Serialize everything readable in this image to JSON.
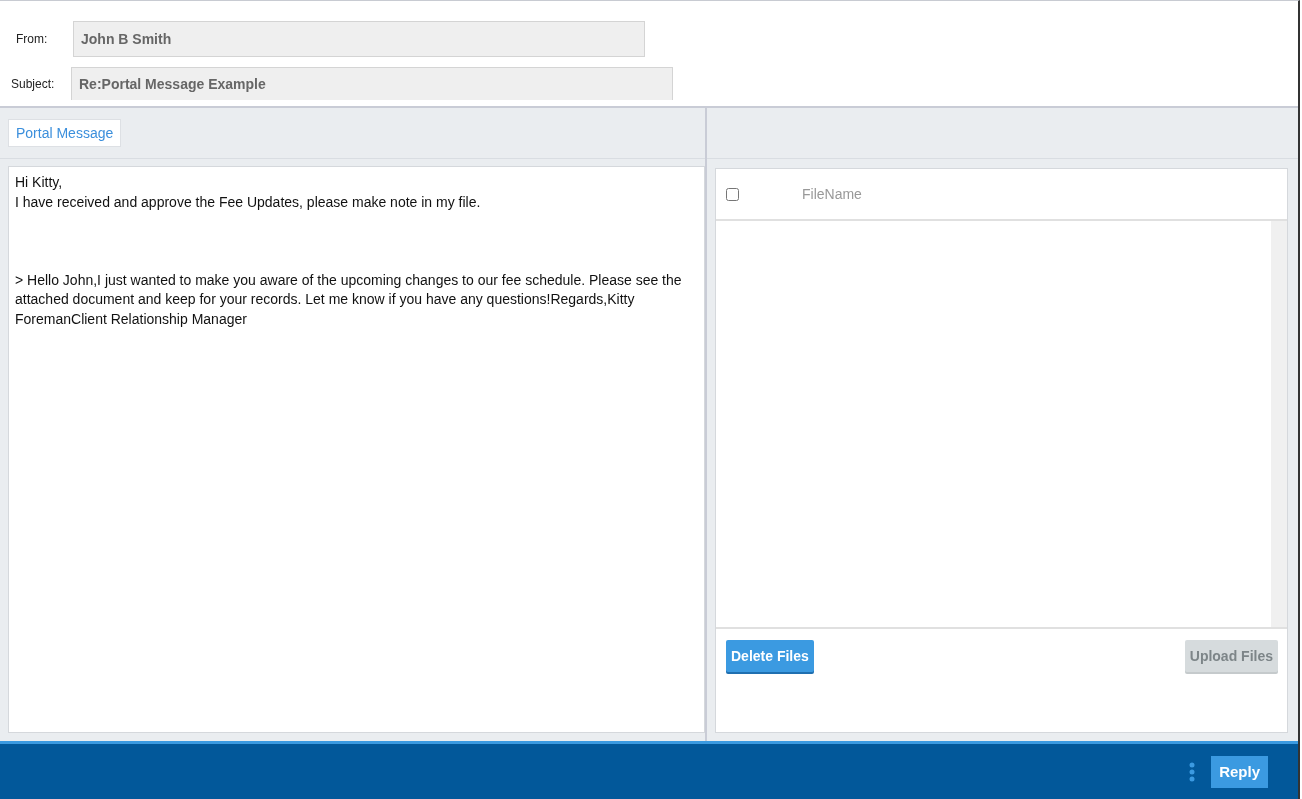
{
  "header": {
    "fields": [
      {
        "label": "From:",
        "value": "John B Smith"
      },
      {
        "label": "Subject:",
        "value": "Re:Portal Message Example"
      }
    ]
  },
  "tabs": [
    {
      "label": "Portal Message",
      "selected": true
    }
  ],
  "message": {
    "body": "Hi Kitty,\nI have received and approve the Fee Updates, please make note in my file.\n\n\n\n> Hello John,I just wanted to make you aware of the upcoming changes to our fee schedule. Please see the attached document and keep for your records. Let me know if you have any questions!Regards,Kitty ForemanClient Relationship Manager"
  },
  "files": {
    "select_all": {
      "checked": false
    },
    "columns": [
      "FileName"
    ],
    "buttons": [
      {
        "label": "Delete Files",
        "disabled": false
      },
      {
        "label": "Upload Files",
        "disabled": true
      }
    ]
  },
  "footer": {
    "buttons": [
      "Reply"
    ]
  }
}
